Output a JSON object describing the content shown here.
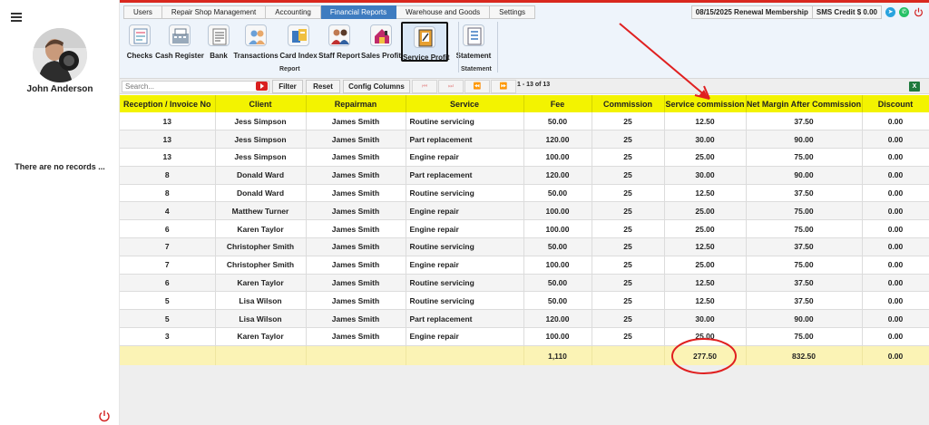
{
  "user": {
    "name": "John Anderson"
  },
  "sidebar": {
    "empty_text": "There are no records ..."
  },
  "menu": [
    {
      "label": "Users",
      "active": false
    },
    {
      "label": "Repair Shop Management",
      "active": false
    },
    {
      "label": "Accounting",
      "active": false
    },
    {
      "label": "Financial Reports",
      "active": true
    },
    {
      "label": "Warehouse and Goods",
      "active": false
    },
    {
      "label": "Settings",
      "active": false
    }
  ],
  "header": {
    "renewal": "08/15/2025 Renewal Membership",
    "sms": "SMS Credit $ 0.00",
    "icons": [
      "telegram-icon",
      "whatsapp-icon",
      "power-icon"
    ]
  },
  "toolbar": {
    "report_group_label": "Report",
    "statement_group_label": "Statement",
    "items": [
      {
        "label": "Checks",
        "icon": "checks-icon"
      },
      {
        "label": "Cash Register",
        "icon": "cash-register-icon"
      },
      {
        "label": "Bank",
        "icon": "bank-icon"
      },
      {
        "label": "Transactions",
        "icon": "transactions-icon"
      },
      {
        "label": "Card Index",
        "icon": "card-index-icon"
      },
      {
        "label": "Staff Report",
        "icon": "staff-report-icon"
      },
      {
        "label": "Sales Profit",
        "icon": "sales-profit-icon"
      },
      {
        "label": "Service Profit",
        "icon": "service-profit-icon",
        "selected": true
      },
      {
        "label": "Statement",
        "icon": "statement-icon"
      }
    ]
  },
  "filterbar": {
    "search_placeholder": "Search...",
    "filter_label": "Filter",
    "reset_label": "Reset",
    "config_label": "Config Columns",
    "pager": [
      "⏮",
      "⏭",
      "⏪",
      "⏩"
    ],
    "page_info": "1 - 13 of 13"
  },
  "table": {
    "columns": [
      "Reception / Invoice No",
      "Client",
      "Repairman",
      "Service",
      "Fee",
      "Commission",
      "Service commission",
      "Net Margin After Commission",
      "Discount"
    ],
    "rows": [
      [
        "13",
        "Jess Simpson",
        "James Smith",
        "Routine servicing",
        "50.00",
        "25",
        "12.50",
        "37.50",
        "0.00"
      ],
      [
        "13",
        "Jess Simpson",
        "James Smith",
        "Part replacement",
        "120.00",
        "25",
        "30.00",
        "90.00",
        "0.00"
      ],
      [
        "13",
        "Jess Simpson",
        "James Smith",
        "Engine repair",
        "100.00",
        "25",
        "25.00",
        "75.00",
        "0.00"
      ],
      [
        "8",
        "Donald Ward",
        "James Smith",
        "Part replacement",
        "120.00",
        "25",
        "30.00",
        "90.00",
        "0.00"
      ],
      [
        "8",
        "Donald Ward",
        "James Smith",
        "Routine servicing",
        "50.00",
        "25",
        "12.50",
        "37.50",
        "0.00"
      ],
      [
        "4",
        "Matthew Turner",
        "James Smith",
        "Engine repair",
        "100.00",
        "25",
        "25.00",
        "75.00",
        "0.00"
      ],
      [
        "6",
        "Karen Taylor",
        "James Smith",
        "Engine repair",
        "100.00",
        "25",
        "25.00",
        "75.00",
        "0.00"
      ],
      [
        "7",
        "Christopher Smith",
        "James Smith",
        "Routine servicing",
        "50.00",
        "25",
        "12.50",
        "37.50",
        "0.00"
      ],
      [
        "7",
        "Christopher Smith",
        "James Smith",
        "Engine repair",
        "100.00",
        "25",
        "25.00",
        "75.00",
        "0.00"
      ],
      [
        "6",
        "Karen Taylor",
        "James Smith",
        "Routine servicing",
        "50.00",
        "25",
        "12.50",
        "37.50",
        "0.00"
      ],
      [
        "5",
        "Lisa Wilson",
        "James Smith",
        "Routine servicing",
        "50.00",
        "25",
        "12.50",
        "37.50",
        "0.00"
      ],
      [
        "5",
        "Lisa Wilson",
        "James Smith",
        "Part replacement",
        "120.00",
        "25",
        "30.00",
        "90.00",
        "0.00"
      ],
      [
        "3",
        "Karen Taylor",
        "James Smith",
        "Engine repair",
        "100.00",
        "25",
        "25.00",
        "75.00",
        "0.00"
      ]
    ],
    "totals": [
      "",
      "",
      "",
      "",
      "1,110",
      "",
      "277.50",
      "832.50",
      "0.00"
    ]
  },
  "colors": {
    "accent_tab": "#3e7cc0",
    "header_yellow": "#f3f300",
    "total_row": "#fbf3b5",
    "annotation_red": "#e02020"
  }
}
